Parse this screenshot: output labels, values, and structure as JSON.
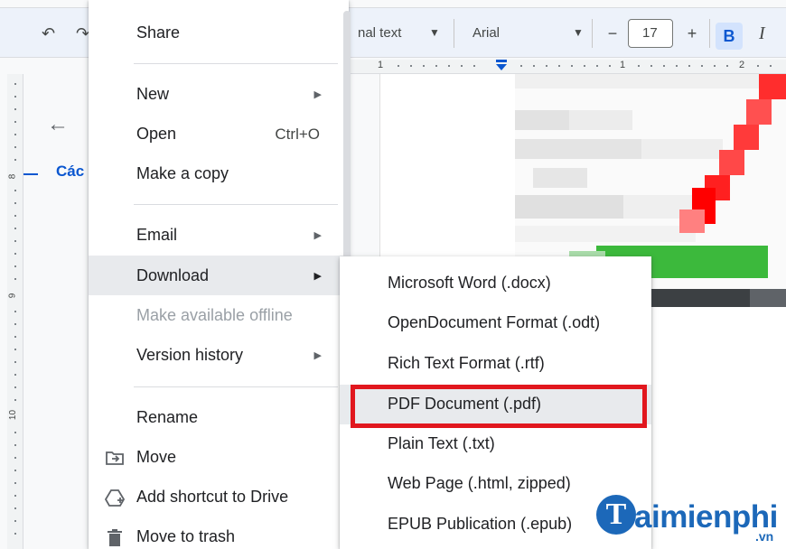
{
  "toolbar": {
    "style_label": "nal text",
    "font_label": "Arial",
    "font_size": "17",
    "minus": "−",
    "plus": "+",
    "bold": "B",
    "italic": "I"
  },
  "ruler": {
    "marks": [
      "1",
      "1",
      "2"
    ],
    "side_numbers": [
      "8",
      "9",
      "10"
    ]
  },
  "outline": {
    "heading": "Các"
  },
  "file_menu": {
    "items": [
      {
        "label": "Share"
      },
      {
        "label": "New"
      },
      {
        "label": "Open",
        "shortcut": "Ctrl+O"
      },
      {
        "label": "Make a copy"
      },
      {
        "label": "Email"
      },
      {
        "label": "Download"
      },
      {
        "label": "Make available offline"
      },
      {
        "label": "Version history"
      },
      {
        "label": "Rename"
      },
      {
        "label": "Move"
      },
      {
        "label": "Add shortcut to Drive"
      },
      {
        "label": "Move to trash"
      }
    ]
  },
  "download_submenu": {
    "items": [
      {
        "label": "Microsoft Word (.docx)"
      },
      {
        "label": "OpenDocument Format (.odt)"
      },
      {
        "label": "Rich Text Format (.rtf)"
      },
      {
        "label": "PDF Document (.pdf)"
      },
      {
        "label": "Plain Text (.txt)"
      },
      {
        "label": "Web Page (.html, zipped)"
      },
      {
        "label": "EPUB Publication (.epub)"
      }
    ]
  },
  "watermark": {
    "initial": "T",
    "text": "aimienphi",
    "suffix": ".vn"
  },
  "colors": {
    "highlight_box": "#e1171e",
    "arrow": "#e1171e",
    "brand_blue": "#1c68b9",
    "link_blue": "#0b57d0"
  }
}
